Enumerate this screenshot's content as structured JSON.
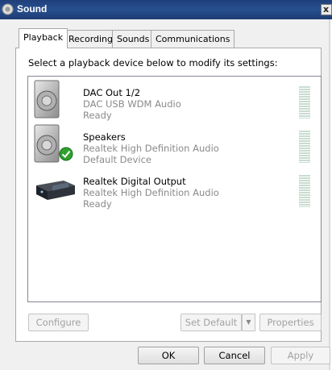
{
  "window": {
    "title": "Sound",
    "close_label": "x"
  },
  "tabs": [
    {
      "label": "Playback",
      "active": true
    },
    {
      "label": "Recording",
      "active": false
    },
    {
      "label": "Sounds",
      "active": false
    },
    {
      "label": "Communications",
      "active": false
    }
  ],
  "instruction": "Select a playback device below to modify its settings:",
  "devices": [
    {
      "name": "DAC Out 1/2",
      "description": "DAC USB WDM Audio",
      "status": "Ready",
      "icon": "speaker-icon",
      "is_default": false
    },
    {
      "name": "Speakers",
      "description": "Realtek High Definition Audio",
      "status": "Default Device",
      "icon": "speaker-icon",
      "is_default": true
    },
    {
      "name": "Realtek Digital Output",
      "description": "Realtek High Definition Audio",
      "status": "Ready",
      "icon": "digital-output-device-icon",
      "is_default": false
    }
  ],
  "buttons": {
    "configure": "Configure",
    "set_default": "Set Default",
    "properties": "Properties",
    "ok": "OK",
    "cancel": "Cancel",
    "apply": "Apply"
  },
  "colors": {
    "titlebar": "#1f3f7a",
    "default_check": "#2fa12f",
    "meter": "#c9dcd1"
  }
}
